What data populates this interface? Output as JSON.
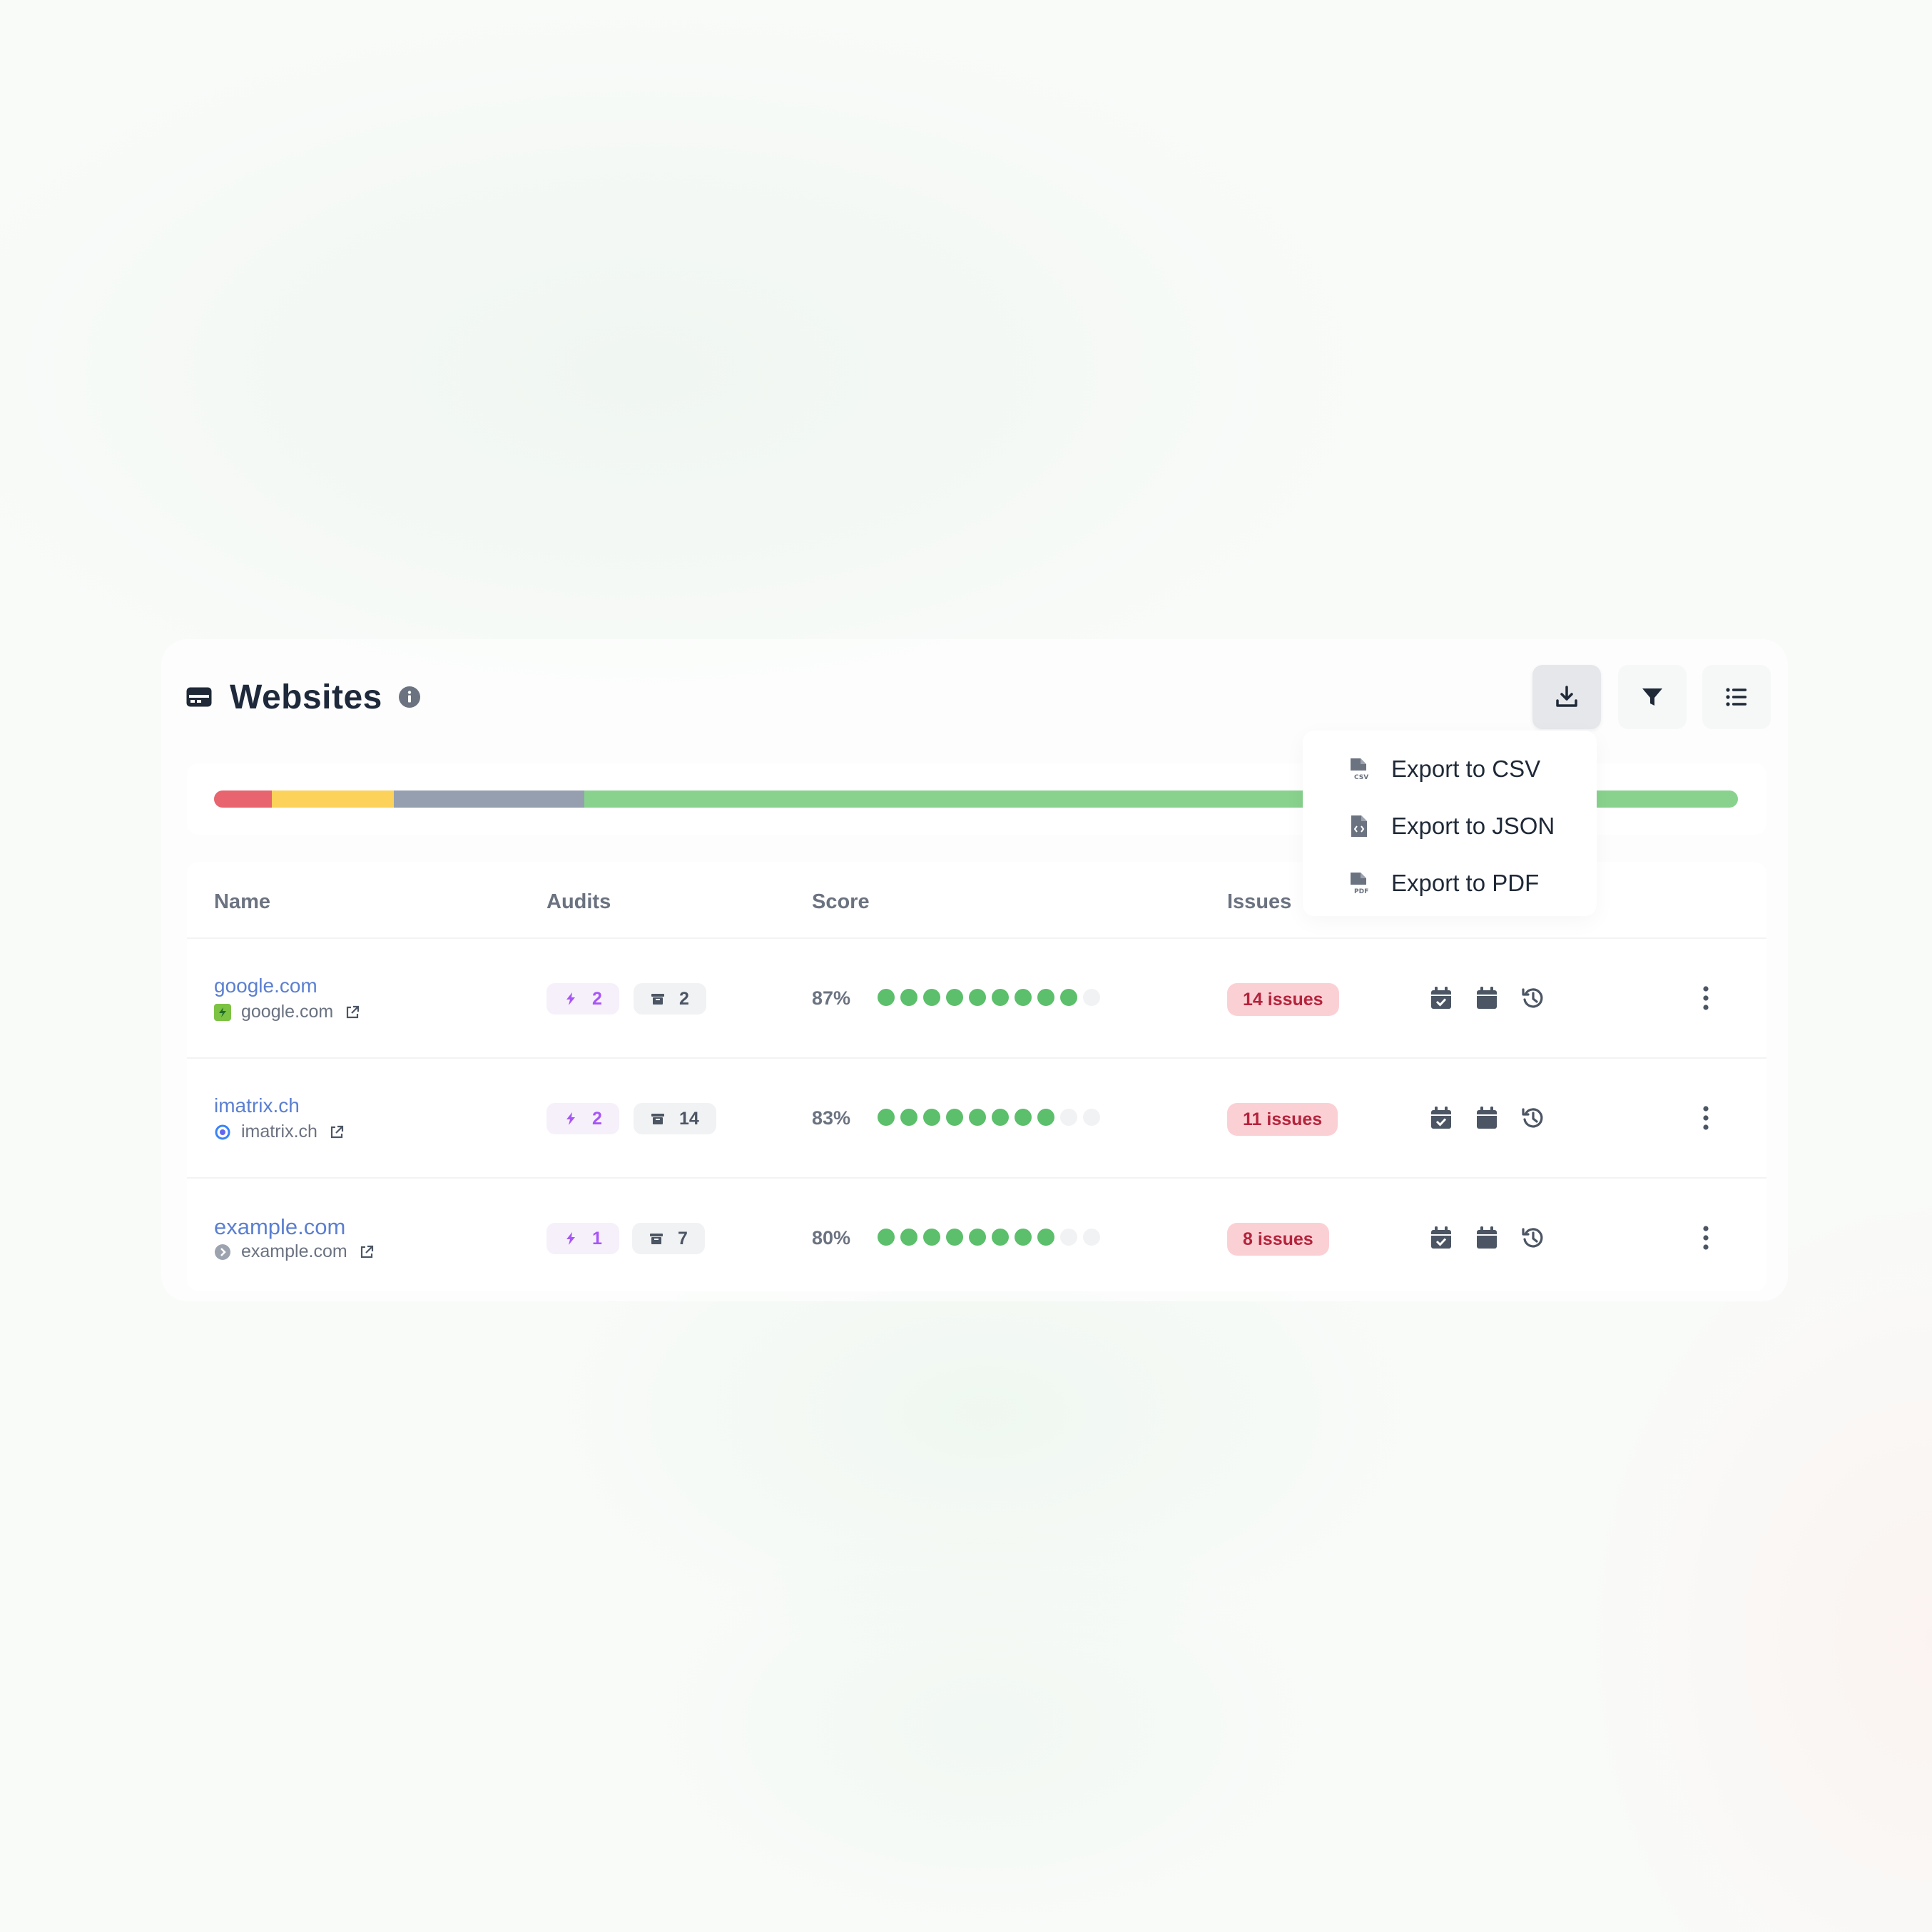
{
  "header": {
    "title": "Websites",
    "title_icon": "website-card-icon",
    "info_icon": "info-icon",
    "toolbar": [
      {
        "icon": "download-icon",
        "active": true
      },
      {
        "icon": "filter-icon",
        "active": false
      },
      {
        "icon": "list-icon",
        "active": false
      }
    ]
  },
  "status_bar": {
    "segments": [
      {
        "color": "#e8646f",
        "fraction": 0.038
      },
      {
        "color": "#fcd25a",
        "fraction": 0.08
      },
      {
        "color": "#959fb0",
        "fraction": 0.125
      },
      {
        "color": "#88d28d",
        "fraction": 0.757
      }
    ]
  },
  "export_menu": {
    "items": [
      {
        "label": "Export to CSV",
        "icon": "file-csv-icon"
      },
      {
        "label": "Export to JSON",
        "icon": "file-code-icon"
      },
      {
        "label": "Export to PDF",
        "icon": "file-pdf-icon"
      }
    ]
  },
  "table": {
    "columns": {
      "name": "Name",
      "audits": "Audits",
      "score": "Score",
      "issues": "Issues"
    },
    "rows": [
      {
        "name": "google.com",
        "domain": "google.com",
        "favicon": "google-favicon-icon",
        "audits_live": "2",
        "audits_archived": "2",
        "score": "87%",
        "dots_filled": 9,
        "dots_total": 10,
        "issues": "14 issues"
      },
      {
        "name": "imatrix.ch",
        "domain": "imatrix.ch",
        "favicon": "imatrix-favicon-icon",
        "audits_live": "2",
        "audits_archived": "14",
        "score": "83%",
        "dots_filled": 8,
        "dots_total": 10,
        "issues": "11 issues"
      },
      {
        "name": "example.com",
        "domain": "example.com",
        "favicon": "default-favicon-icon",
        "audits_live": "1",
        "audits_archived": "7",
        "score": "80%",
        "dots_filled": 8,
        "dots_total": 10,
        "issues": "8 issues"
      }
    ],
    "row_actions": [
      "calendar-check-icon",
      "calendar-icon",
      "history-icon",
      "more-vertical-icon"
    ]
  },
  "colors": {
    "dot_on": "#5cbf6b",
    "dot_off": "#f1f2f4",
    "link": "#5b7fd1",
    "issue_bg": "#fbd0d5",
    "issue_text": "#b4233b",
    "icon": "#4b5563"
  }
}
